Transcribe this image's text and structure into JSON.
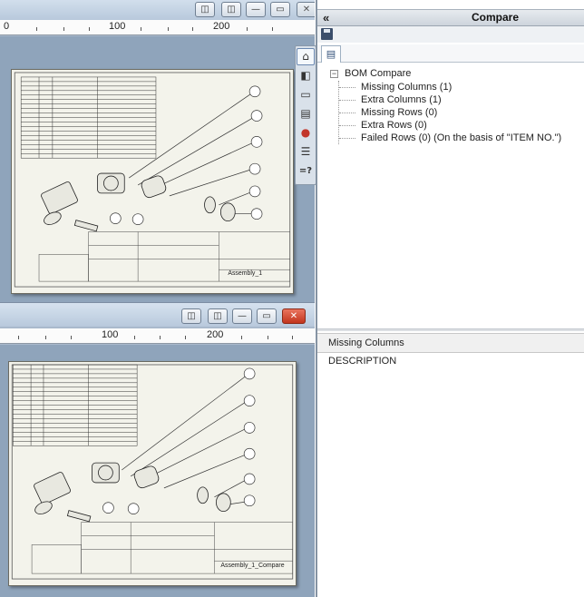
{
  "window1": {
    "ruler_labels": [
      "0",
      "100",
      "200"
    ],
    "buttons": [
      "◫",
      "◫",
      "—",
      "▭",
      "✕"
    ]
  },
  "window2": {
    "ruler_labels": [
      "100",
      "200"
    ],
    "buttons": [
      "◫",
      "◫",
      "—",
      "▭",
      "✕"
    ]
  },
  "icon_strip": [
    {
      "icon": "home-icon",
      "glyph": "⌂"
    },
    {
      "icon": "model-icon",
      "glyph": "◧"
    },
    {
      "icon": "folder-icon",
      "glyph": "▭"
    },
    {
      "icon": "view-palette-icon",
      "glyph": "▤"
    },
    {
      "icon": "appearance-icon",
      "glyph": "●"
    },
    {
      "icon": "properties-icon",
      "glyph": "☰"
    },
    {
      "icon": "custom-properties-icon",
      "glyph": "=?"
    }
  ],
  "compare": {
    "collapse": "«",
    "title": "Compare",
    "tree": {
      "expander": "−",
      "root": "BOM Compare",
      "items": [
        "Missing Columns (1)",
        "Extra Columns (1)",
        "Missing Rows (0)",
        "Extra Rows (0)",
        "Failed Rows (0) (On the basis of \"ITEM NO.\")"
      ]
    },
    "details": {
      "header": "Missing Columns",
      "rows": [
        "DESCRIPTION"
      ]
    }
  },
  "drawings": {
    "sheet1_title": "Assembly_1",
    "sheet2_title": "Assembly_1_Compare"
  },
  "colors": {
    "window_bg": "#a9b9cc",
    "sheet_bg": "#f3f3eb",
    "panel_header": "#cdd4dc",
    "close_button": "#c2351d"
  }
}
